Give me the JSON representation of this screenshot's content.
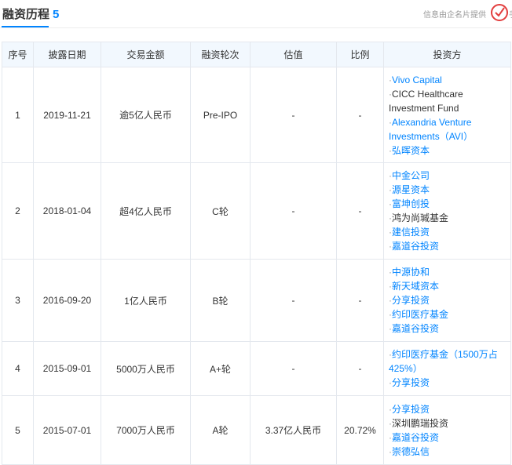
{
  "header": {
    "title": "融资历程",
    "count": "5",
    "source_note": "信息由企名片提供",
    "seal_tail": "手"
  },
  "columns": [
    "序号",
    "披露日期",
    "交易金额",
    "融资轮次",
    "估值",
    "比例",
    "投资方"
  ],
  "rows": [
    {
      "no": "1",
      "date": "2019-11-21",
      "amount": "逾5亿人民币",
      "round": "Pre-IPO",
      "valuation": "-",
      "ratio": "-",
      "investors": [
        {
          "name": "Vivo Capital",
          "link": true
        },
        {
          "name": "CICC Healthcare Investment Fund",
          "link": false
        },
        {
          "name": "Alexandria Venture Investments（AVI）",
          "link": true
        },
        {
          "name": "弘晖资本",
          "link": true
        }
      ]
    },
    {
      "no": "2",
      "date": "2018-01-04",
      "amount": "超4亿人民币",
      "round": "C轮",
      "valuation": "-",
      "ratio": "-",
      "investors": [
        {
          "name": "中金公司",
          "link": true
        },
        {
          "name": "源星资本",
          "link": true
        },
        {
          "name": "富坤创投",
          "link": true
        },
        {
          "name": "鸿为尚瑊基金",
          "link": false
        },
        {
          "name": "建信投资",
          "link": true
        },
        {
          "name": "嘉道谷投资",
          "link": true
        }
      ]
    },
    {
      "no": "3",
      "date": "2016-09-20",
      "amount": "1亿人民币",
      "round": "B轮",
      "valuation": "-",
      "ratio": "-",
      "investors": [
        {
          "name": "中源协和",
          "link": true
        },
        {
          "name": "新天域资本",
          "link": true
        },
        {
          "name": "分享投资",
          "link": true
        },
        {
          "name": "约印医疗基金",
          "link": true
        },
        {
          "name": "嘉道谷投资",
          "link": true
        }
      ]
    },
    {
      "no": "4",
      "date": "2015-09-01",
      "amount": "5000万人民币",
      "round": "A+轮",
      "valuation": "-",
      "ratio": "-",
      "investors": [
        {
          "name": "约印医疗基金（1500万占425%）",
          "link": true
        },
        {
          "name": "分享投资",
          "link": true
        }
      ]
    },
    {
      "no": "5",
      "date": "2015-07-01",
      "amount": "7000万人民币",
      "round": "A轮",
      "valuation": "3.37亿人民币",
      "ratio": "20.72%",
      "investors": [
        {
          "name": "分享投资",
          "link": true
        },
        {
          "name": "深圳鹏瑞投资",
          "link": false
        },
        {
          "name": "嘉道谷投资",
          "link": true
        },
        {
          "name": "崇德弘信",
          "link": true
        }
      ]
    }
  ],
  "colors": {
    "accent": "#0084ff",
    "header_bg": "#f2f8fe",
    "border": "#e4e8ee",
    "seal": "#e23d3d"
  }
}
